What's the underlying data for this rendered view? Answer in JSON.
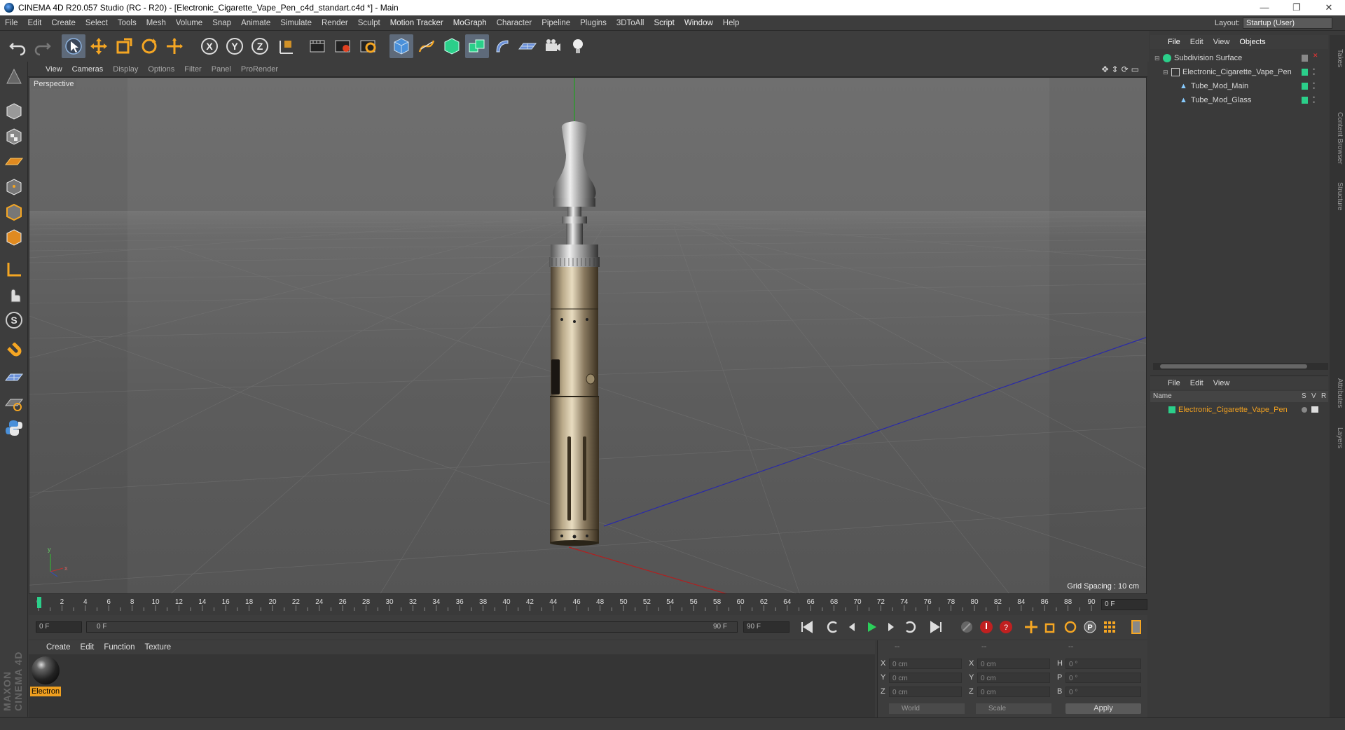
{
  "window": {
    "title": "CINEMA 4D R20.057 Studio (RC - R20) - [Electronic_Cigarette_Vape_Pen_c4d_standart.c4d *] - Main",
    "controls": [
      "—",
      "❐",
      "✕"
    ]
  },
  "menubar": {
    "items": [
      "File",
      "Edit",
      "Create",
      "Select",
      "Tools",
      "Mesh",
      "Volume",
      "Snap",
      "Animate",
      "Simulate",
      "Render",
      "Sculpt",
      "Motion Tracker",
      "MoGraph",
      "Character",
      "Pipeline",
      "Plugins",
      "3DToAll",
      "Script",
      "Window",
      "Help"
    ],
    "layout_label": "Layout:",
    "layout_value": "Startup (User)"
  },
  "toolbar": {
    "icons": [
      "undo-icon",
      "redo-icon",
      "select-icon",
      "move-icon",
      "scale-icon",
      "rotate-icon",
      "transform-icon",
      "x-axis-icon",
      "y-axis-icon",
      "z-axis-icon",
      "coordinate-system-icon",
      "render-view-icon",
      "render-picture-viewer-icon",
      "edit-render-settings-icon",
      "cube-icon",
      "pen-spline-icon",
      "subdivision-icon",
      "cloner-icon",
      "deformer-icon",
      "floor-icon",
      "camera-icon",
      "light-icon"
    ]
  },
  "viewport": {
    "menu": [
      "View",
      "Cameras",
      "Display",
      "Options",
      "Filter",
      "Panel",
      "ProRender"
    ],
    "label": "Perspective",
    "grid_spacing": "Grid Spacing : 10 cm",
    "axis_y": "y",
    "axis_x": "x"
  },
  "timeline": {
    "ticks": [
      "0",
      "2",
      "4",
      "6",
      "8",
      "10",
      "12",
      "14",
      "16",
      "18",
      "20",
      "22",
      "24",
      "26",
      "28",
      "30",
      "32",
      "34",
      "36",
      "38",
      "40",
      "42",
      "44",
      "46",
      "48",
      "50",
      "52",
      "54",
      "56",
      "58",
      "60",
      "62",
      "64",
      "66",
      "68",
      "70",
      "72",
      "74",
      "76",
      "78",
      "80",
      "82",
      "84",
      "86",
      "88",
      "90"
    ],
    "current_frame": "0 F",
    "start_field": "0 F",
    "range_start": "0 F",
    "range_end": "90 F",
    "end_field": "90 F"
  },
  "material_manager": {
    "menu": [
      "Create",
      "Edit",
      "Function",
      "Texture"
    ],
    "material_name": "Electron"
  },
  "coordinates": {
    "header": [
      "--",
      "--",
      "--"
    ],
    "rows": [
      {
        "a_label": "X",
        "a_value": "0 cm",
        "b_label": "X",
        "b_value": "0 cm",
        "c_label": "H",
        "c_value": "0 °"
      },
      {
        "a_label": "Y",
        "a_value": "0 cm",
        "b_label": "Y",
        "b_value": "0 cm",
        "c_label": "P",
        "c_value": "0 °"
      },
      {
        "a_label": "Z",
        "a_value": "0 cm",
        "b_label": "Z",
        "b_value": "0 cm",
        "c_label": "B",
        "c_value": "0 °"
      }
    ],
    "world_dropdown": "World",
    "scale_dropdown": "Scale",
    "apply": "Apply"
  },
  "object_manager": {
    "menu": [
      "File",
      "Edit",
      "View",
      "Objects"
    ],
    "tree": [
      {
        "label": "Subdivision Surface",
        "indent": 0
      },
      {
        "label": "Electronic_Cigarette_Vape_Pen",
        "indent": 1
      },
      {
        "label": "Tube_Mod_Main",
        "indent": 2
      },
      {
        "label": "Tube_Mod_Glass",
        "indent": 2
      }
    ]
  },
  "layer_manager": {
    "menu": [
      "File",
      "Edit",
      "View"
    ],
    "col_name": "Name",
    "col_s": "S",
    "col_v": "V",
    "col_r": "R",
    "layer": "Electronic_Cigarette_Vape_Pen"
  },
  "right_tabs": [
    "Takes",
    "Content Browser",
    "Structure",
    "Attributes",
    "Layers"
  ],
  "colors": {
    "accent": "#f0a020",
    "layer_green": "#2bcf8a",
    "viewport_bg": "#6a6a6a"
  }
}
